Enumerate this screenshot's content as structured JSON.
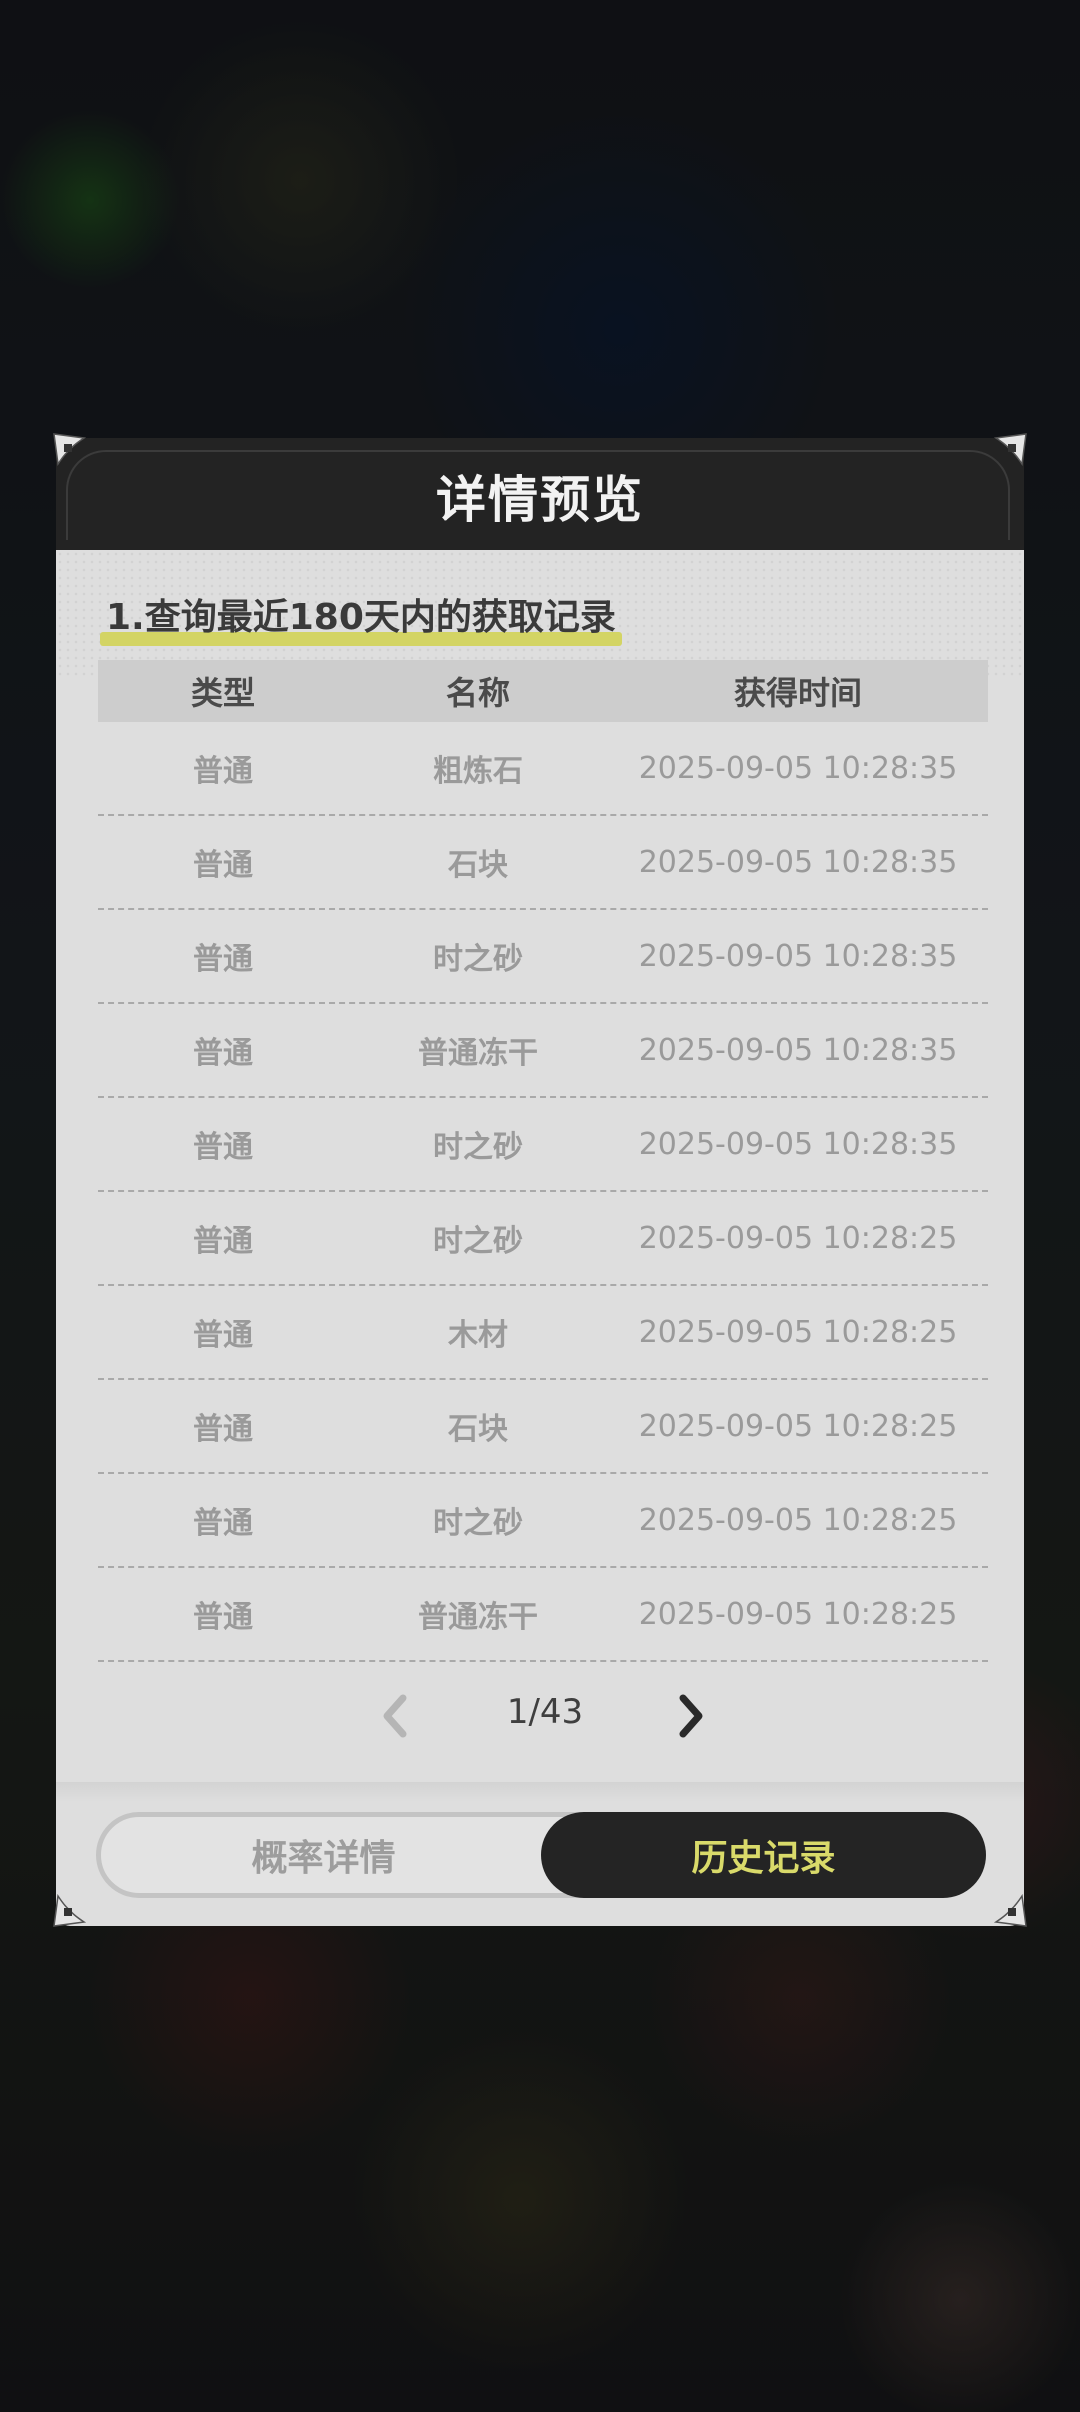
{
  "dialog": {
    "title": "详情预览",
    "subtitle": "1.查询最近180天内的获取记录"
  },
  "table": {
    "headers": [
      "类型",
      "名称",
      "获得时间"
    ],
    "rows": [
      {
        "type": "普通",
        "name": "粗炼石",
        "time": "2025-09-05 10:28:35"
      },
      {
        "type": "普通",
        "name": "石块",
        "time": "2025-09-05 10:28:35"
      },
      {
        "type": "普通",
        "name": "时之砂",
        "time": "2025-09-05 10:28:35"
      },
      {
        "type": "普通",
        "name": "普通冻干",
        "time": "2025-09-05 10:28:35"
      },
      {
        "type": "普通",
        "name": "时之砂",
        "time": "2025-09-05 10:28:35"
      },
      {
        "type": "普通",
        "name": "时之砂",
        "time": "2025-09-05 10:28:25"
      },
      {
        "type": "普通",
        "name": "木材",
        "time": "2025-09-05 10:28:25"
      },
      {
        "type": "普通",
        "name": "石块",
        "time": "2025-09-05 10:28:25"
      },
      {
        "type": "普通",
        "name": "时之砂",
        "time": "2025-09-05 10:28:25"
      },
      {
        "type": "普通",
        "name": "普通冻干",
        "time": "2025-09-05 10:28:25"
      }
    ]
  },
  "pagination": {
    "indicator": "1/43",
    "prev_icon": "chevron-left-icon",
    "next_icon": "chevron-right-icon"
  },
  "tabs": {
    "probability": "概率详情",
    "history": "历史记录",
    "active": "history"
  },
  "colors": {
    "header_bg": "#232323",
    "body_bg": "#dedede",
    "accent_yellow": "#d9da6a",
    "highlight_yellow": "#d3d464"
  }
}
